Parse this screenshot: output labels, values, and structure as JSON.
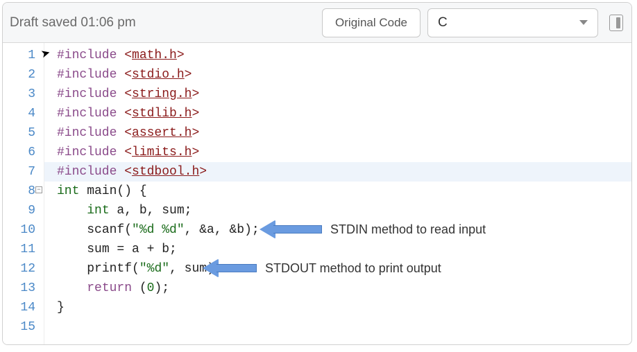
{
  "toolbar": {
    "status": "Draft saved 01:06 pm",
    "original_code_label": "Original Code",
    "language_selected": "C"
  },
  "gutter": [
    "1",
    "2",
    "3",
    "4",
    "5",
    "6",
    "7",
    "8",
    "9",
    "10",
    "11",
    "12",
    "13",
    "14",
    "15"
  ],
  "code": {
    "l1": {
      "pre": "#include ",
      "open": "<",
      "hdr": "math.h",
      "close": ">"
    },
    "l2": {
      "pre": "#include ",
      "open": "<",
      "hdr": "stdio.h",
      "close": ">"
    },
    "l3": {
      "pre": "#include ",
      "open": "<",
      "hdr": "string.h",
      "close": ">"
    },
    "l4": {
      "pre": "#include ",
      "open": "<",
      "hdr": "stdlib.h",
      "close": ">"
    },
    "l5": {
      "pre": "#include ",
      "open": "<",
      "hdr": "assert.h",
      "close": ">"
    },
    "l6": {
      "pre": "#include ",
      "open": "<",
      "hdr": "limits.h",
      "close": ">"
    },
    "l7": {
      "pre": "#include ",
      "open": "<",
      "hdr": "stdbool.h",
      "close": ">"
    },
    "l8": {
      "type": "int",
      "rest": " main() {"
    },
    "l9": {
      "indent": "    ",
      "type": "int",
      "rest": " a, b, sum;"
    },
    "l10": {
      "indent": "    ",
      "fn": "scanf(",
      "str": "\"%d %d\"",
      "rest": ", &a, &b);"
    },
    "l11": {
      "indent": "    ",
      "rest": "sum = a + b;"
    },
    "l12": {
      "indent": "    ",
      "fn": "printf(",
      "str": "\"%d\"",
      "rest": ", sum);"
    },
    "l13": {
      "indent": "    ",
      "kw": "return",
      "sp": " (",
      "num": "0",
      "tail": ");"
    },
    "l14": {
      "rest": "}"
    }
  },
  "annotations": {
    "a1": "STDIN method to read input",
    "a2": "STDOUT method to print output"
  }
}
